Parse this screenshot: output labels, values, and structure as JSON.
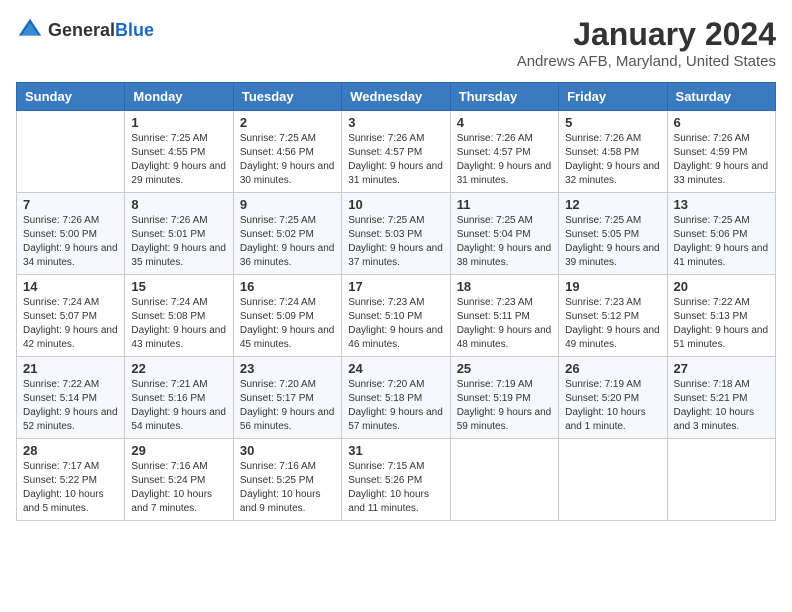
{
  "logo": {
    "general": "General",
    "blue": "Blue"
  },
  "header": {
    "month_year": "January 2024",
    "location": "Andrews AFB, Maryland, United States"
  },
  "days_of_week": [
    "Sunday",
    "Monday",
    "Tuesday",
    "Wednesday",
    "Thursday",
    "Friday",
    "Saturday"
  ],
  "weeks": [
    [
      {
        "day": "",
        "sunrise": "",
        "sunset": "",
        "daylight": ""
      },
      {
        "day": "1",
        "sunrise": "Sunrise: 7:25 AM",
        "sunset": "Sunset: 4:55 PM",
        "daylight": "Daylight: 9 hours and 29 minutes."
      },
      {
        "day": "2",
        "sunrise": "Sunrise: 7:25 AM",
        "sunset": "Sunset: 4:56 PM",
        "daylight": "Daylight: 9 hours and 30 minutes."
      },
      {
        "day": "3",
        "sunrise": "Sunrise: 7:26 AM",
        "sunset": "Sunset: 4:57 PM",
        "daylight": "Daylight: 9 hours and 31 minutes."
      },
      {
        "day": "4",
        "sunrise": "Sunrise: 7:26 AM",
        "sunset": "Sunset: 4:57 PM",
        "daylight": "Daylight: 9 hours and 31 minutes."
      },
      {
        "day": "5",
        "sunrise": "Sunrise: 7:26 AM",
        "sunset": "Sunset: 4:58 PM",
        "daylight": "Daylight: 9 hours and 32 minutes."
      },
      {
        "day": "6",
        "sunrise": "Sunrise: 7:26 AM",
        "sunset": "Sunset: 4:59 PM",
        "daylight": "Daylight: 9 hours and 33 minutes."
      }
    ],
    [
      {
        "day": "7",
        "sunrise": "Sunrise: 7:26 AM",
        "sunset": "Sunset: 5:00 PM",
        "daylight": "Daylight: 9 hours and 34 minutes."
      },
      {
        "day": "8",
        "sunrise": "Sunrise: 7:26 AM",
        "sunset": "Sunset: 5:01 PM",
        "daylight": "Daylight: 9 hours and 35 minutes."
      },
      {
        "day": "9",
        "sunrise": "Sunrise: 7:25 AM",
        "sunset": "Sunset: 5:02 PM",
        "daylight": "Daylight: 9 hours and 36 minutes."
      },
      {
        "day": "10",
        "sunrise": "Sunrise: 7:25 AM",
        "sunset": "Sunset: 5:03 PM",
        "daylight": "Daylight: 9 hours and 37 minutes."
      },
      {
        "day": "11",
        "sunrise": "Sunrise: 7:25 AM",
        "sunset": "Sunset: 5:04 PM",
        "daylight": "Daylight: 9 hours and 38 minutes."
      },
      {
        "day": "12",
        "sunrise": "Sunrise: 7:25 AM",
        "sunset": "Sunset: 5:05 PM",
        "daylight": "Daylight: 9 hours and 39 minutes."
      },
      {
        "day": "13",
        "sunrise": "Sunrise: 7:25 AM",
        "sunset": "Sunset: 5:06 PM",
        "daylight": "Daylight: 9 hours and 41 minutes."
      }
    ],
    [
      {
        "day": "14",
        "sunrise": "Sunrise: 7:24 AM",
        "sunset": "Sunset: 5:07 PM",
        "daylight": "Daylight: 9 hours and 42 minutes."
      },
      {
        "day": "15",
        "sunrise": "Sunrise: 7:24 AM",
        "sunset": "Sunset: 5:08 PM",
        "daylight": "Daylight: 9 hours and 43 minutes."
      },
      {
        "day": "16",
        "sunrise": "Sunrise: 7:24 AM",
        "sunset": "Sunset: 5:09 PM",
        "daylight": "Daylight: 9 hours and 45 minutes."
      },
      {
        "day": "17",
        "sunrise": "Sunrise: 7:23 AM",
        "sunset": "Sunset: 5:10 PM",
        "daylight": "Daylight: 9 hours and 46 minutes."
      },
      {
        "day": "18",
        "sunrise": "Sunrise: 7:23 AM",
        "sunset": "Sunset: 5:11 PM",
        "daylight": "Daylight: 9 hours and 48 minutes."
      },
      {
        "day": "19",
        "sunrise": "Sunrise: 7:23 AM",
        "sunset": "Sunset: 5:12 PM",
        "daylight": "Daylight: 9 hours and 49 minutes."
      },
      {
        "day": "20",
        "sunrise": "Sunrise: 7:22 AM",
        "sunset": "Sunset: 5:13 PM",
        "daylight": "Daylight: 9 hours and 51 minutes."
      }
    ],
    [
      {
        "day": "21",
        "sunrise": "Sunrise: 7:22 AM",
        "sunset": "Sunset: 5:14 PM",
        "daylight": "Daylight: 9 hours and 52 minutes."
      },
      {
        "day": "22",
        "sunrise": "Sunrise: 7:21 AM",
        "sunset": "Sunset: 5:16 PM",
        "daylight": "Daylight: 9 hours and 54 minutes."
      },
      {
        "day": "23",
        "sunrise": "Sunrise: 7:20 AM",
        "sunset": "Sunset: 5:17 PM",
        "daylight": "Daylight: 9 hours and 56 minutes."
      },
      {
        "day": "24",
        "sunrise": "Sunrise: 7:20 AM",
        "sunset": "Sunset: 5:18 PM",
        "daylight": "Daylight: 9 hours and 57 minutes."
      },
      {
        "day": "25",
        "sunrise": "Sunrise: 7:19 AM",
        "sunset": "Sunset: 5:19 PM",
        "daylight": "Daylight: 9 hours and 59 minutes."
      },
      {
        "day": "26",
        "sunrise": "Sunrise: 7:19 AM",
        "sunset": "Sunset: 5:20 PM",
        "daylight": "Daylight: 10 hours and 1 minute."
      },
      {
        "day": "27",
        "sunrise": "Sunrise: 7:18 AM",
        "sunset": "Sunset: 5:21 PM",
        "daylight": "Daylight: 10 hours and 3 minutes."
      }
    ],
    [
      {
        "day": "28",
        "sunrise": "Sunrise: 7:17 AM",
        "sunset": "Sunset: 5:22 PM",
        "daylight": "Daylight: 10 hours and 5 minutes."
      },
      {
        "day": "29",
        "sunrise": "Sunrise: 7:16 AM",
        "sunset": "Sunset: 5:24 PM",
        "daylight": "Daylight: 10 hours and 7 minutes."
      },
      {
        "day": "30",
        "sunrise": "Sunrise: 7:16 AM",
        "sunset": "Sunset: 5:25 PM",
        "daylight": "Daylight: 10 hours and 9 minutes."
      },
      {
        "day": "31",
        "sunrise": "Sunrise: 7:15 AM",
        "sunset": "Sunset: 5:26 PM",
        "daylight": "Daylight: 10 hours and 11 minutes."
      },
      {
        "day": "",
        "sunrise": "",
        "sunset": "",
        "daylight": ""
      },
      {
        "day": "",
        "sunrise": "",
        "sunset": "",
        "daylight": ""
      },
      {
        "day": "",
        "sunrise": "",
        "sunset": "",
        "daylight": ""
      }
    ]
  ]
}
